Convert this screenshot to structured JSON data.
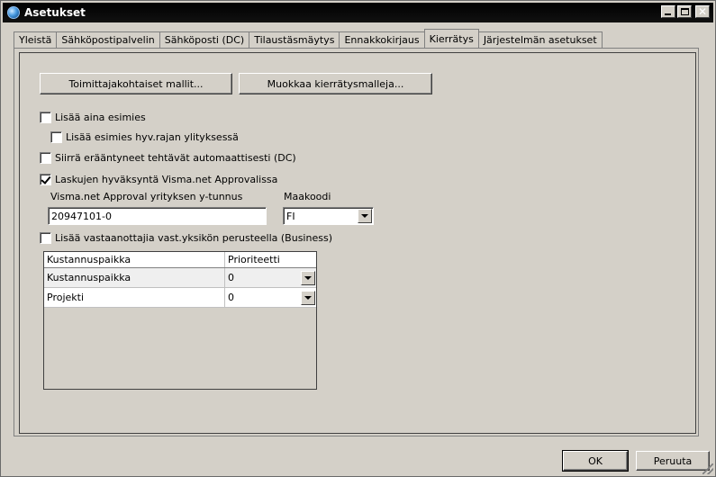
{
  "window": {
    "title": "Asetukset",
    "icons": {
      "app": "app-globe-icon",
      "minimize": "minimize-icon",
      "maximize": "maximize-icon",
      "close": "close-icon"
    }
  },
  "tabs": [
    {
      "label": "Yleistä",
      "active": false
    },
    {
      "label": "Sähköpostipalvelin",
      "active": false
    },
    {
      "label": "Sähköposti (DC)",
      "active": false
    },
    {
      "label": "Tilaustäsmäytys",
      "active": false
    },
    {
      "label": "Ennakkokirjaus",
      "active": false
    },
    {
      "label": "Kierrätys",
      "active": true
    },
    {
      "label": "Järjestelmän asetukset",
      "active": false
    }
  ],
  "buttons": {
    "supplier_templates": "Toimittajakohtaiset mallit...",
    "edit_templates": "Muokkaa kierrätysmalleja..."
  },
  "checkboxes": {
    "always_add_supervisor": {
      "label": "Lisää aina esimies",
      "checked": false
    },
    "add_supervisor_limit": {
      "label": "Lisää esimies hyv.rajan ylityksessä",
      "checked": false
    },
    "move_expired_tasks": {
      "label": "Siirrä erääntyneet tehtävät automaattisesti (DC)",
      "checked": false
    },
    "visma_approval": {
      "label": "Laskujen hyväksyntä Visma.net Approvalissa",
      "checked": true
    },
    "add_recipients_by_unit": {
      "label": "Lisää vastaanottajia vast.yksikön perusteella (Business)",
      "checked": false
    }
  },
  "visma": {
    "business_id_label": "Visma.net Approval yrityksen y-tunnus",
    "business_id_value": "20947101-0",
    "country_code_label": "Maakoodi",
    "country_code_value": "FI"
  },
  "grid": {
    "headers": [
      "Kustannuspaikka",
      "Prioriteetti"
    ],
    "rows": [
      {
        "name": "Kustannuspaikka",
        "priority": "0"
      },
      {
        "name": "Projekti",
        "priority": "0"
      }
    ]
  },
  "footer": {
    "ok": "OK",
    "cancel": "Peruuta"
  }
}
